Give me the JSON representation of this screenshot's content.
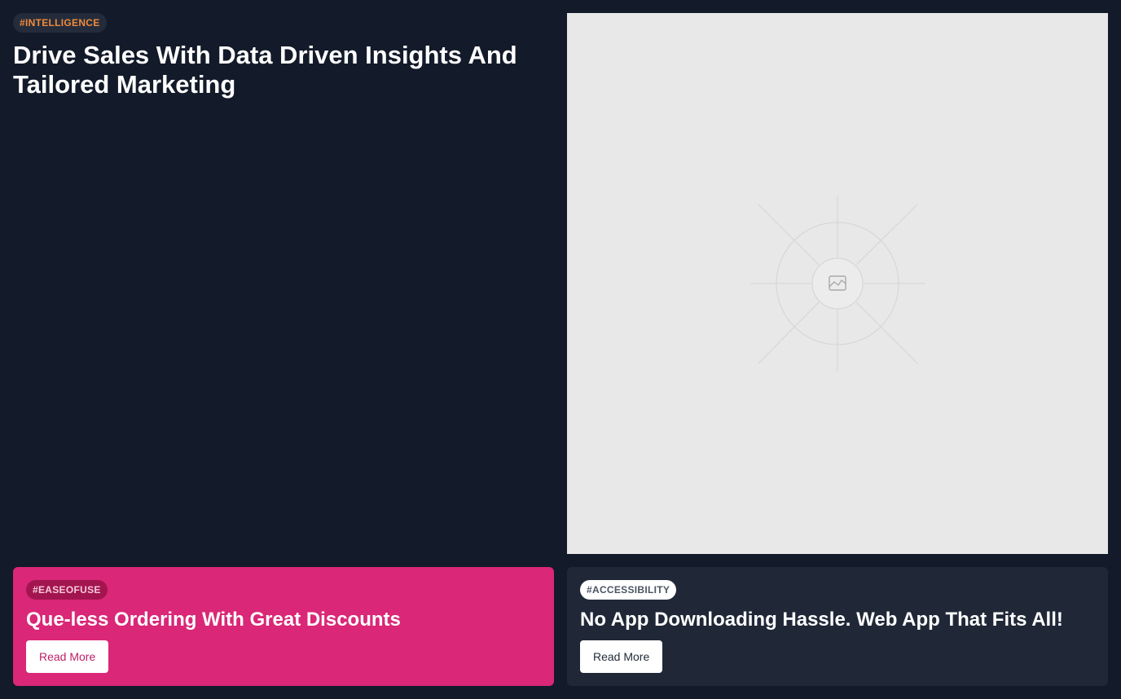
{
  "hero": {
    "tag": "#INTELLIGENCE",
    "title": "Drive Sales With Data Driven Insights And Tailored Marketing"
  },
  "image_card": {
    "icon": "image-placeholder-icon"
  },
  "cards": [
    {
      "tag": "#EASEOFUSE",
      "title": "Que-less Ordering With Great Discounts",
      "button_label": "Read More"
    },
    {
      "tag": "#ACCESSIBILITY",
      "title": "No App Downloading Hassle. Web App That Fits All!",
      "button_label": "Read More"
    }
  ],
  "colors": {
    "background": "#131a29",
    "pink_card": "#da2777",
    "dark_card": "#202838",
    "hero_tag_text": "#f08a3c",
    "image_placeholder": "#e8e8e8"
  }
}
